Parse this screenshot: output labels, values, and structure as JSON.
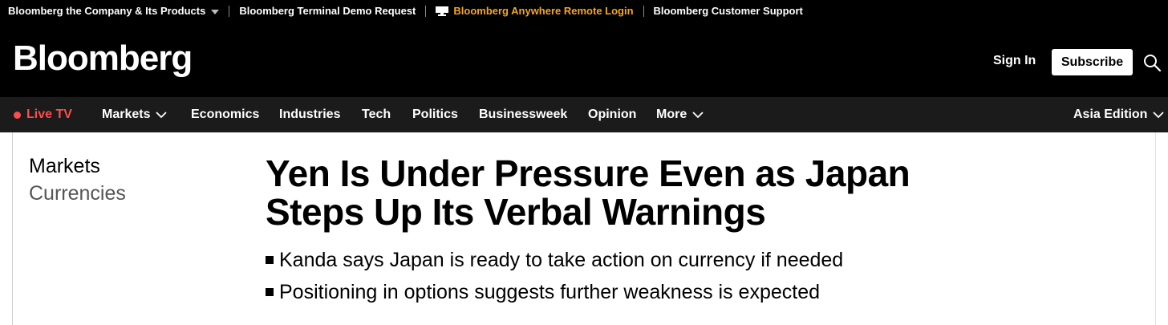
{
  "utility_bar": {
    "company": "Bloomberg the Company & Its Products",
    "terminal_demo": "Bloomberg Terminal Demo Request",
    "anywhere_login": "Bloomberg Anywhere Remote Login",
    "support": "Bloomberg Customer Support"
  },
  "header": {
    "logo": "Bloomberg",
    "sign_in": "Sign In",
    "subscribe": "Subscribe"
  },
  "nav": {
    "live_tv": "Live TV",
    "items": [
      "Markets",
      "Economics",
      "Industries",
      "Tech",
      "Politics",
      "Businessweek",
      "Opinion",
      "More"
    ],
    "edition": "Asia Edition"
  },
  "article": {
    "section": "Markets",
    "subsection": "Currencies",
    "headline": "Yen Is Under Pressure Even as Japan Steps Up Its Verbal Warnings",
    "bullets": [
      "Kanda says Japan is ready to take action on currency if needed",
      "Positioning in options suggests further weakness is expected"
    ]
  },
  "colors": {
    "background_dark": "#000000",
    "nav_bg": "#1b1b1b",
    "live_red": "#ff4c4c",
    "accent_orange": "#f5a623"
  },
  "icons": [
    "caret-down-icon",
    "terminal-icon",
    "search-icon",
    "chevron-down-icon",
    "live-dot-icon"
  ]
}
